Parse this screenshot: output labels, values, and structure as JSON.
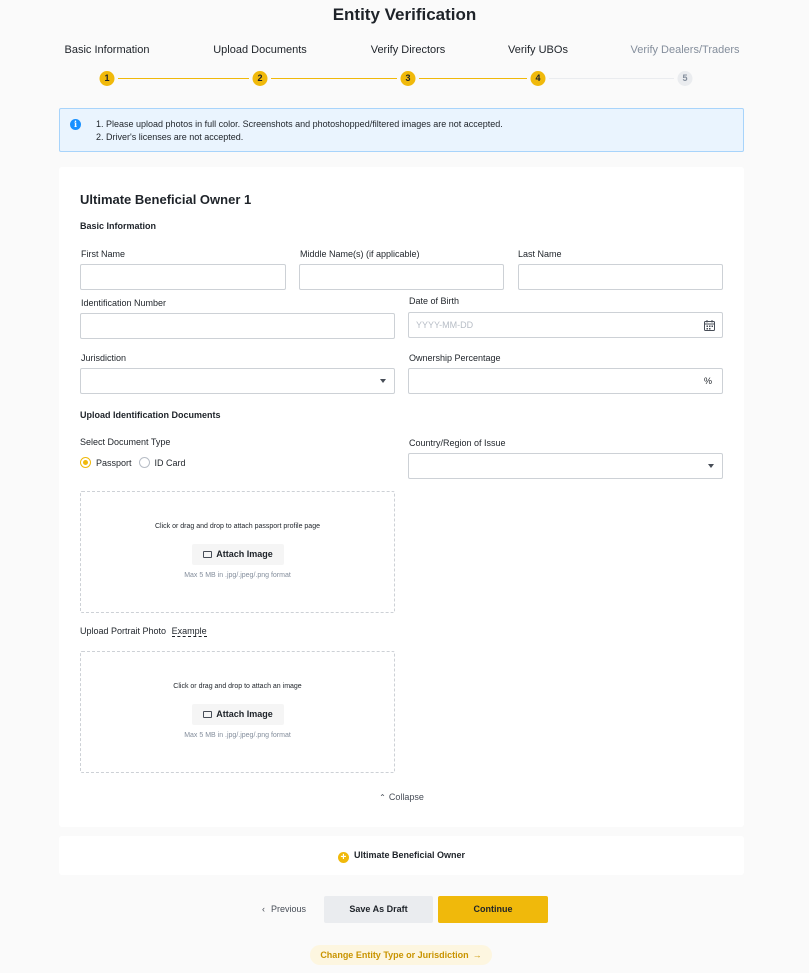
{
  "page": {
    "title": "Entity Verification"
  },
  "stepper": {
    "steps": [
      {
        "label": "Basic Information",
        "number": "1",
        "state": "done"
      },
      {
        "label": "Upload Documents",
        "number": "2",
        "state": "done"
      },
      {
        "label": "Verify Directors",
        "number": "3",
        "state": "done"
      },
      {
        "label": "Verify UBOs",
        "number": "4",
        "state": "current"
      },
      {
        "label": "Verify Dealers/Traders",
        "number": "5",
        "state": "pending"
      }
    ]
  },
  "notice": {
    "icon": "info-icon",
    "lines": [
      "1. Please upload photos in full color. Screenshots and photoshopped/filtered images are not accepted.",
      "2. Driver's licenses are not accepted."
    ]
  },
  "owner_form": {
    "title": "Ultimate Beneficial Owner 1",
    "basic_section": "Basic Information",
    "first_name": {
      "label": "First Name",
      "value": ""
    },
    "middle_name": {
      "label": "Middle Name(s) (if applicable)",
      "value": ""
    },
    "last_name": {
      "label": "Last Name",
      "value": ""
    },
    "id_number": {
      "label": "Identification Number",
      "value": ""
    },
    "dob": {
      "label": "Date of Birth",
      "placeholder": "YYYY-MM-DD",
      "icon": "calendar-icon"
    },
    "jurisdiction": {
      "label": "Jurisdiction",
      "value": ""
    },
    "ownership": {
      "label": "Ownership Percentage",
      "value": "",
      "suffix": "%"
    },
    "upload_section": "Upload Identification Documents",
    "doc_type": {
      "label": "Select Document Type",
      "options": [
        "Passport",
        "ID Card"
      ],
      "selected": "Passport"
    },
    "issue_country": {
      "label": "Country/Region of Issue",
      "value": ""
    },
    "passport_drop": {
      "text": "Click or drag and drop to attach passport profile page",
      "button": "Attach Image",
      "hint": "Max 5 MB in .jpg/.jpeg/.png format"
    },
    "portrait": {
      "label": "Upload Portrait Photo",
      "example_link": "Example",
      "text": "Click or drag and drop to attach an image",
      "button": "Attach Image",
      "hint": "Max 5 MB in .jpg/.jpeg/.png format"
    },
    "collapse_label": "Collapse"
  },
  "add_owner": {
    "label": "Ultimate Beneficial Owner"
  },
  "actions": {
    "previous": "Previous",
    "save_draft": "Save As Draft",
    "continue": "Continue",
    "change_entity": "Change Entity Type or Jurisdiction"
  },
  "colors": {
    "accent": "#f0b90b",
    "info": "#1890ff",
    "info_bg": "#eaf4fe"
  }
}
